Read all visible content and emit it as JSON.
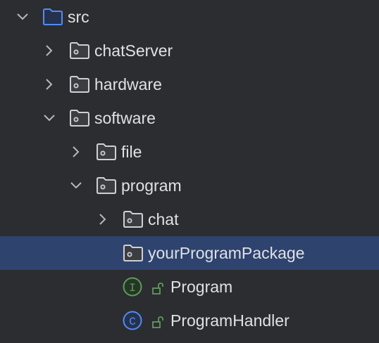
{
  "tree": [
    {
      "label": "src",
      "level": 0,
      "chevron": "expanded",
      "icon": "source-folder-icon"
    },
    {
      "label": "chatServer",
      "level": 1,
      "chevron": "collapsed",
      "icon": "package-icon"
    },
    {
      "label": "hardware",
      "level": 1,
      "chevron": "collapsed",
      "icon": "package-icon"
    },
    {
      "label": "software",
      "level": 1,
      "chevron": "expanded",
      "icon": "package-icon"
    },
    {
      "label": "file",
      "level": 2,
      "chevron": "collapsed",
      "icon": "package-icon"
    },
    {
      "label": "program",
      "level": 2,
      "chevron": "expanded",
      "icon": "package-icon"
    },
    {
      "label": "chat",
      "level": 3,
      "chevron": "collapsed",
      "icon": "package-icon"
    },
    {
      "label": "yourProgramPackage",
      "level": 3,
      "chevron": "none",
      "icon": "package-icon",
      "selected": true
    },
    {
      "label": "Program",
      "level": 3,
      "chevron": "none",
      "icon": "interface-icon",
      "letter": "I",
      "public": true
    },
    {
      "label": "ProgramHandler",
      "level": 3,
      "chevron": "none",
      "icon": "class-icon",
      "letter": "C",
      "public": true
    }
  ],
  "colors": {
    "background": "#2b2d30",
    "selection": "#2e436e",
    "text": "#dfe1e5",
    "interface": "#5f9b5a",
    "class": "#548af7",
    "source_folder": "#548af7"
  }
}
